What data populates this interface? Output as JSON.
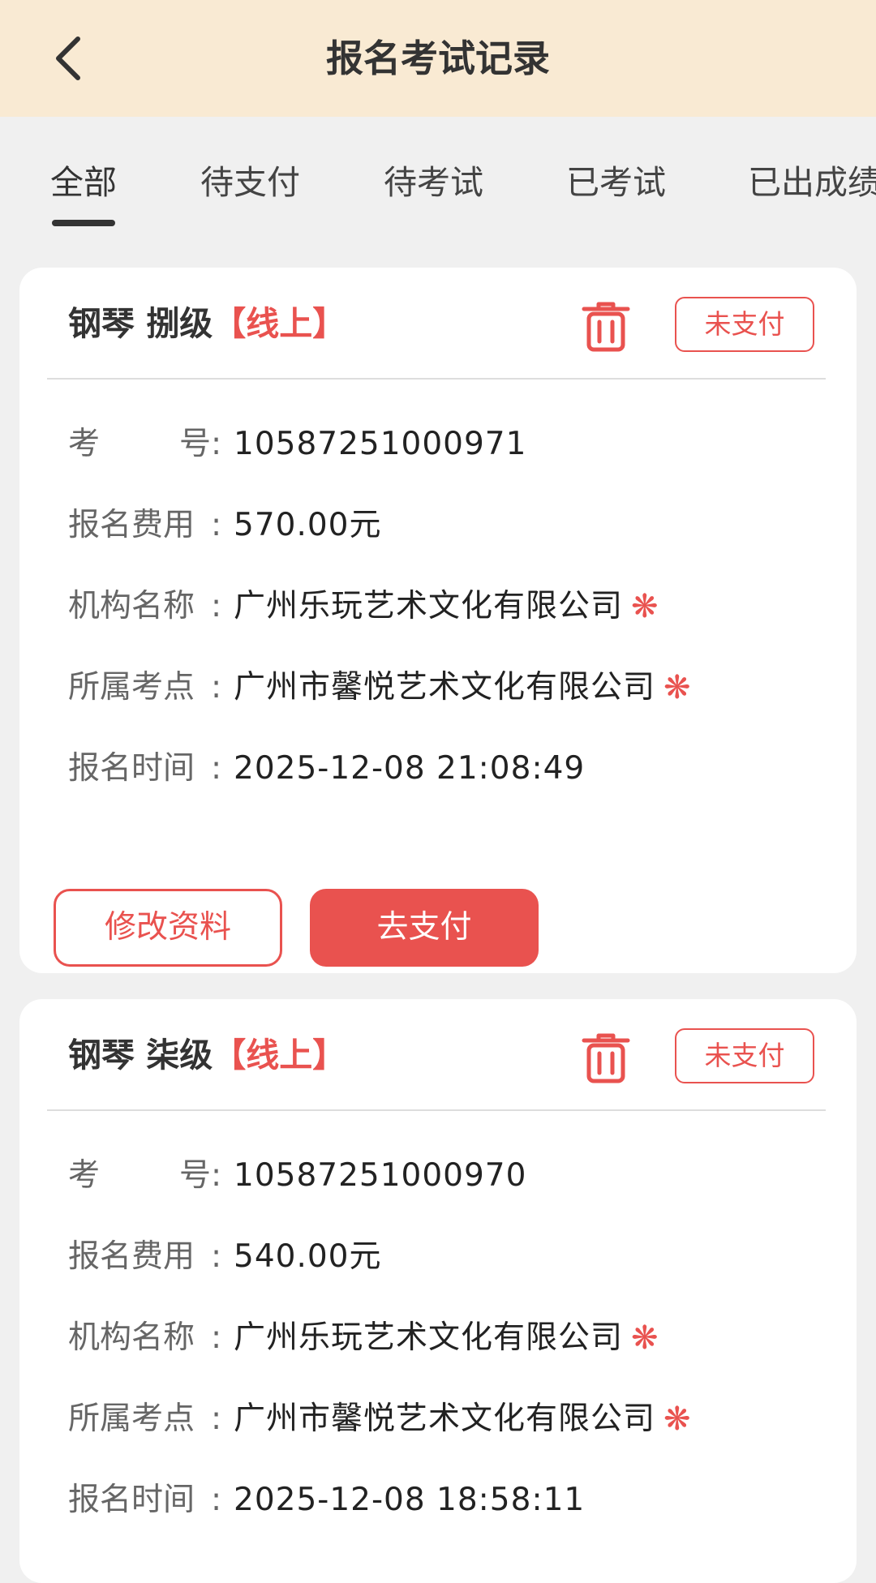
{
  "header": {
    "title": "报名考试记录"
  },
  "tabs": [
    {
      "label": "全部",
      "active": true
    },
    {
      "label": "待支付",
      "active": false
    },
    {
      "label": "待考试",
      "active": false
    },
    {
      "label": "已考试",
      "active": false
    },
    {
      "label": "已出成绩",
      "active": false
    }
  ],
  "labels": {
    "exam_no": "考　　号",
    "fee": "报名费用",
    "institution": "机构名称",
    "exam_site": "所属考点",
    "time": "报名时间",
    "colon": ":"
  },
  "records": [
    {
      "subject": "钢琴",
      "level": "捌级",
      "mode": "【线上】",
      "status": "未支付",
      "exam_no": "10587251000971",
      "fee": "570.00元",
      "institution": "广州乐玩艺术文化有限公司",
      "exam_site": "广州市馨悦艺术文化有限公司",
      "time": "2025-12-08 21:08:49",
      "edit_label": "修改资料",
      "pay_label": "去支付"
    },
    {
      "subject": "钢琴",
      "level": "柒级",
      "mode": "【线上】",
      "status": "未支付",
      "exam_no": "10587251000970",
      "fee": "540.00元",
      "institution": "广州乐玩艺术文化有限公司",
      "exam_site": "广州市馨悦艺术文化有限公司",
      "time": "2025-12-08 18:58:11"
    }
  ],
  "icons": {
    "back": "chevron-left-icon",
    "trash": "trash-icon",
    "verified": "snowflake-badge-icon"
  },
  "colors": {
    "header_bg": "#f9ead3",
    "page_bg": "#f0f0f0",
    "accent": "#e9524f",
    "text_primary": "#333333",
    "text_label": "#666666"
  }
}
